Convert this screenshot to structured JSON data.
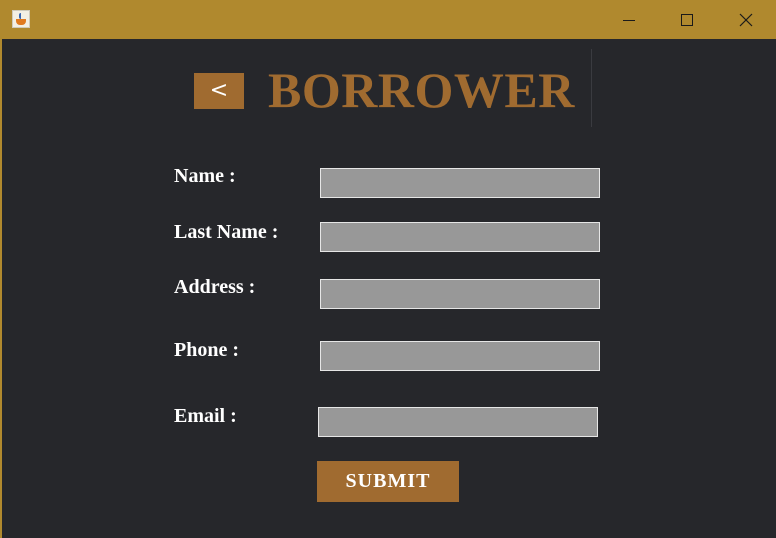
{
  "window": {
    "icon": "java-coffee-cup-icon",
    "controls": [
      "minimize-icon",
      "maximize-icon",
      "close-icon"
    ]
  },
  "header": {
    "back_label": "<",
    "title": "BORROWER"
  },
  "form": {
    "fields": [
      {
        "label": "Name :",
        "value": ""
      },
      {
        "label": "Last Name :",
        "value": ""
      },
      {
        "label": "Address :",
        "value": ""
      },
      {
        "label": "Phone :",
        "value": ""
      },
      {
        "label": "Email :",
        "value": ""
      }
    ],
    "submit_label": "SUBMIT"
  },
  "colors": {
    "titlebar": "#b0892e",
    "background": "#26272b",
    "accent": "#a06b30",
    "field": "#989898",
    "label_text": "#ffffff"
  }
}
